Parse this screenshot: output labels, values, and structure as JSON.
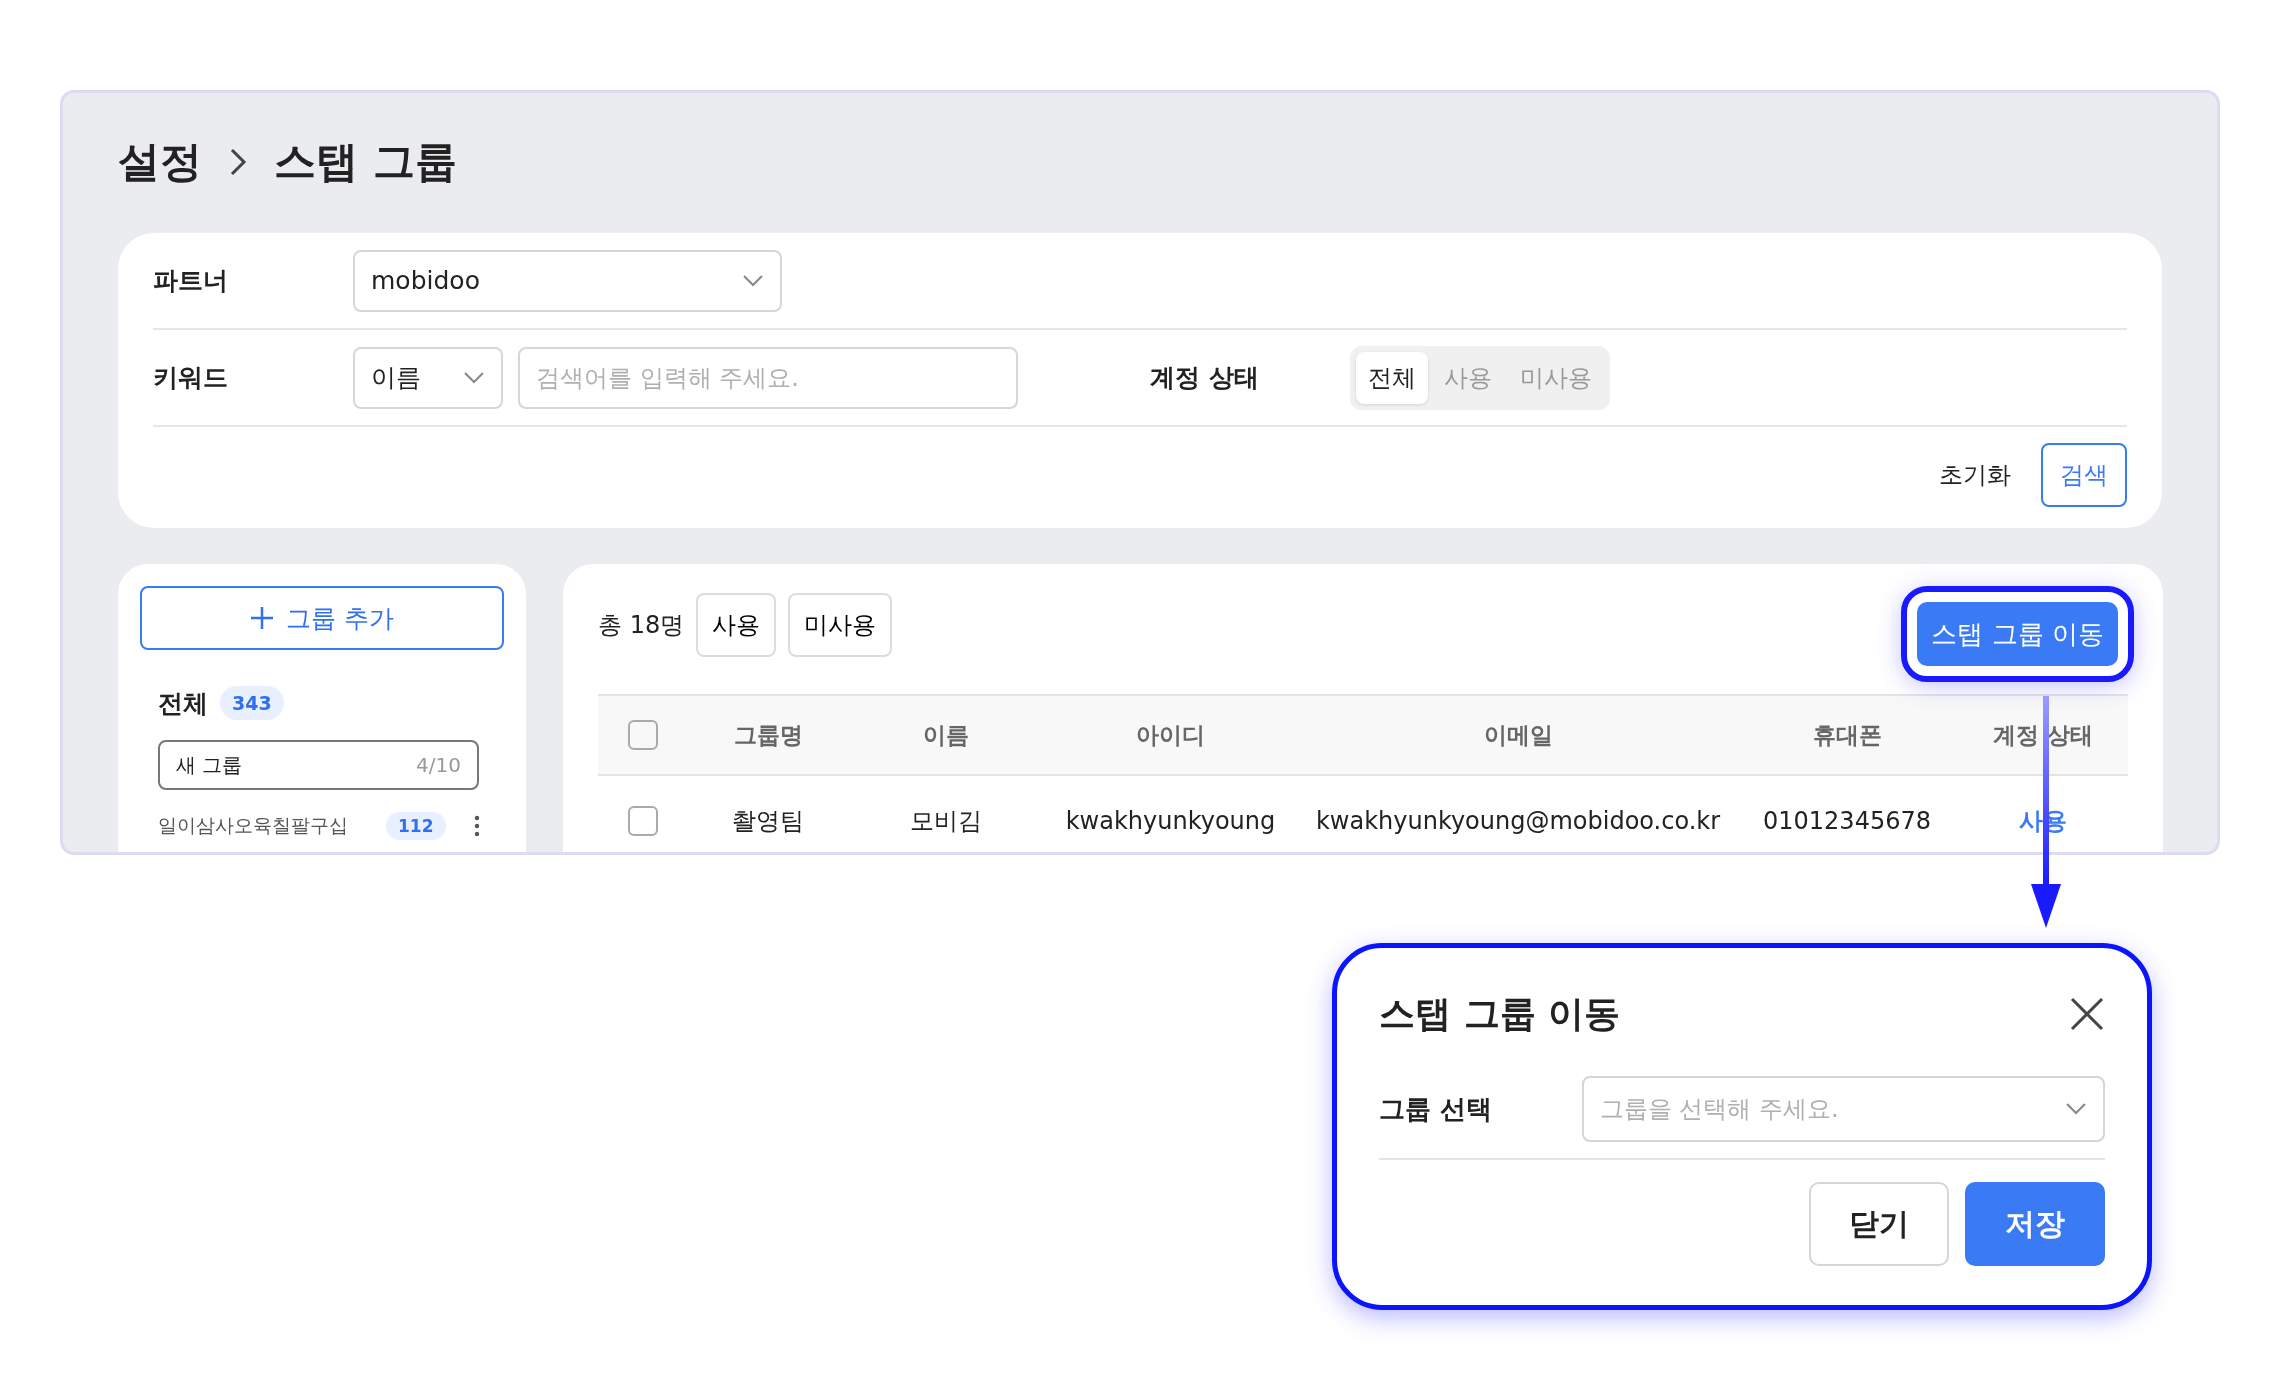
{
  "breadcrumb": [
    {
      "label": "설정"
    },
    {
      "label": "스탭 그룹"
    }
  ],
  "filters": {
    "partner": {
      "label": "파트너",
      "value": "mobidoo"
    },
    "keyword": {
      "label": "키워드",
      "type_value": "이름",
      "placeholder": "검색어를 입력해 주세요."
    },
    "account_status": {
      "label": "계정 상태",
      "options": [
        {
          "label": "전체",
          "selected": true
        },
        {
          "label": "사용",
          "selected": false
        },
        {
          "label": "미사용",
          "selected": false
        }
      ]
    },
    "reset_button": "초기화",
    "search_button": "검색"
  },
  "groups_panel": {
    "add_button": "그룹 추가",
    "all": {
      "label": "전체",
      "count": "343"
    },
    "new_group_field": {
      "value": "새 그룹",
      "counter": "4/10"
    },
    "groups": [
      {
        "name": "일이삼사오육칠팔구십",
        "count": "112"
      }
    ]
  },
  "members": {
    "total": "총 18명",
    "filter_buttons": [
      "사용",
      "미사용"
    ],
    "move_button": "스탭 그룹 이동",
    "header_checked": false,
    "columns": [
      "그룹명",
      "이름",
      "아이디",
      "이메일",
      "휴대폰",
      "계정 상태"
    ],
    "rows": [
      {
        "checked": false,
        "cells": [
          "촬영팀",
          "모비김",
          "kwakhyunkyoung",
          "kwakhyunkyoung@mobidoo.co.kr",
          "01012345678"
        ],
        "status": "사용"
      }
    ]
  },
  "modal": {
    "title": "스탭 그룹 이동",
    "field_label": "그룹 선택",
    "placeholder": "그룹을 선택해 주세요.",
    "buttons": [
      {
        "label": "닫기",
        "kind": "secondary"
      },
      {
        "label": "저장",
        "kind": "primary"
      }
    ]
  }
}
